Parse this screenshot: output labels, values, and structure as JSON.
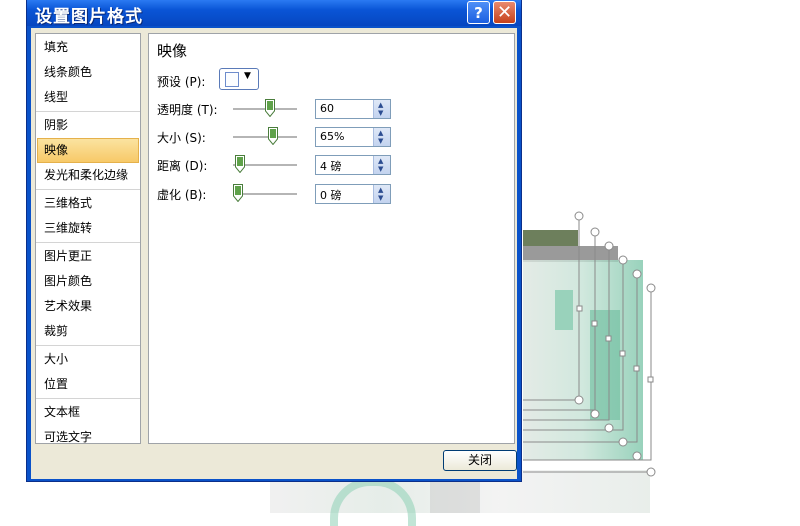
{
  "dialog": {
    "title": "设置图片格式",
    "help_glyph": "?",
    "close_glyph": "✕"
  },
  "nav": {
    "groups": [
      {
        "items": [
          {
            "label": "填充"
          },
          {
            "label": "线条颜色"
          },
          {
            "label": "线型"
          }
        ]
      },
      {
        "items": [
          {
            "label": "阴影"
          },
          {
            "label": "映像",
            "selected": true
          },
          {
            "label": "发光和柔化边缘"
          }
        ]
      },
      {
        "items": [
          {
            "label": "三维格式"
          },
          {
            "label": "三维旋转"
          }
        ]
      },
      {
        "items": [
          {
            "label": "图片更正"
          },
          {
            "label": "图片颜色"
          },
          {
            "label": "艺术效果"
          },
          {
            "label": "裁剪"
          }
        ]
      },
      {
        "items": [
          {
            "label": "大小"
          },
          {
            "label": "位置"
          }
        ]
      },
      {
        "items": [
          {
            "label": "文本框"
          },
          {
            "label": "可选文字"
          }
        ]
      }
    ]
  },
  "panel": {
    "title": "映像",
    "preset": {
      "label": "预设 (P):",
      "arrow": "▼"
    },
    "transparency": {
      "label": "透明度 (T):",
      "value": "60",
      "slider_fraction": 0.6
    },
    "size": {
      "label": "大小 (S):",
      "value": "65%",
      "slider_fraction": 0.65
    },
    "distance": {
      "label": "距离 (D):",
      "value": "4 磅",
      "slider_fraction": 0.04
    },
    "blur": {
      "label": "虚化 (B):",
      "value": "0 磅",
      "slider_fraction": 0.0
    }
  },
  "footer": {
    "close_label": "关闭"
  },
  "colors": {
    "title_bar": "#0a55d6",
    "selected_item": "#f7c968",
    "accent_green": "#5fb89a"
  }
}
